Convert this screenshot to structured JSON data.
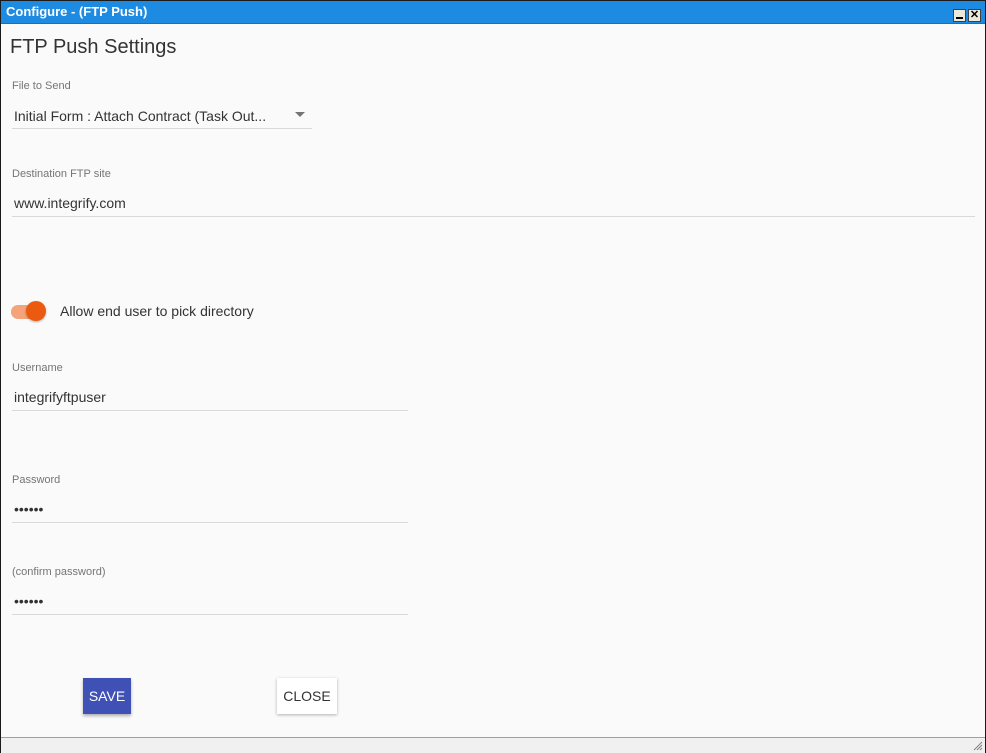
{
  "window": {
    "title": "Configure - (FTP Push)",
    "minimize_glyph": "_",
    "close_glyph": "✕"
  },
  "page": {
    "title": "FTP Push Settings"
  },
  "file_to_send": {
    "label": "File to Send",
    "value": "Initial Form : Attach Contract (Task Out..."
  },
  "destination": {
    "label": "Destination FTP site",
    "value": "www.integrify.com"
  },
  "allow_pick_directory": {
    "label": "Allow end user to pick directory",
    "checked": true
  },
  "username": {
    "label": "Username",
    "value": "integrifyftpuser"
  },
  "password": {
    "label": "Password",
    "value": "••••••"
  },
  "confirm_password": {
    "label": "(confirm password)",
    "value": "••••••"
  },
  "buttons": {
    "save": "SAVE",
    "close": "CLOSE"
  },
  "colors": {
    "titlebar": "#1e8be2",
    "accent": "#ec5a0f",
    "primary_button": "#3f51b5"
  }
}
